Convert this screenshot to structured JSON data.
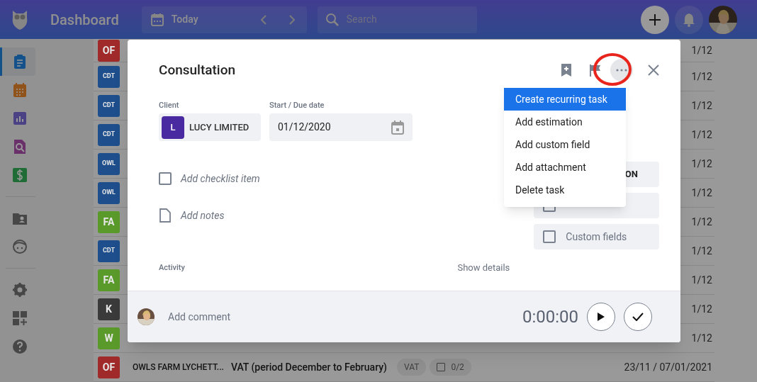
{
  "header": {
    "title": "Dashboard",
    "date_label": "Today",
    "search": {
      "placeholder": "Search"
    }
  },
  "sidebar": {
    "groups": [
      [
        {
          "selected": true
        },
        {
          "selected": false
        },
        {
          "selected": false
        },
        {
          "selected": false
        },
        {
          "selected": false
        }
      ],
      [
        {
          "selected": false
        },
        {
          "selected": false
        }
      ],
      [
        {
          "selected": false
        },
        {
          "selected": false
        },
        {
          "selected": false
        }
      ]
    ]
  },
  "task_rows": [
    {
      "badge": "OF",
      "color": "#a02a2a",
      "date": "1/12"
    },
    {
      "badge": "CDT",
      "color": "#1e4f8c",
      "date": "1/12"
    },
    {
      "badge": "CDT",
      "color": "#1e4f8c",
      "date": "1/12"
    },
    {
      "badge": "CDT",
      "color": "#1e4f8c",
      "date": "1/12"
    },
    {
      "badge": "OWL",
      "color": "#1e4f8c",
      "date": "1/12"
    },
    {
      "badge": "OWL",
      "color": "#1e4f8c",
      "date": "1/12"
    },
    {
      "badge": "FA",
      "color": "#5a9a2a",
      "date": "1/12"
    },
    {
      "badge": "CDT",
      "color": "#1e4f8c",
      "date": "1/12"
    },
    {
      "badge": "FA",
      "color": "#5a9a2a",
      "date": "1/12"
    },
    {
      "badge": "K",
      "color": "#3a3a3a",
      "date": "1/12"
    },
    {
      "badge": "W",
      "color": "#5a9a2a",
      "date": "1/12"
    },
    {
      "badge": "OF",
      "color": "#a02a2a",
      "client": "OWLS FARM LYCHETT...",
      "title": "VAT (period December to February)",
      "tag": "VAT",
      "checklist": "0/2",
      "date": "23/11 / 07/01/2021"
    }
  ],
  "modal": {
    "title": "Consultation",
    "client_label": "Client",
    "client": {
      "initial": "L",
      "name": "LUCY LIMITED"
    },
    "date_label": "Start / Due date",
    "date": "01/12/2020",
    "checklist_item": {
      "placeholder": "Add checklist item",
      "checked": false
    },
    "notes_placeholder": "Add notes",
    "activity_label": "Activity",
    "show_details": "Show details",
    "side_buttons": [
      {
        "kind": "text",
        "label": "ON"
      },
      {
        "kind": "checkbox",
        "checked": false
      },
      {
        "kind": "checkbox",
        "checked": false,
        "label": "Custom fields"
      }
    ],
    "menu": {
      "expanded": true,
      "items": [
        {
          "label": "Create recurring task",
          "selected": true
        },
        {
          "label": "Add estimation",
          "selected": false
        },
        {
          "label": "Add custom field",
          "selected": false
        },
        {
          "label": "Add attachment",
          "selected": false
        },
        {
          "label": "Delete task",
          "selected": false
        }
      ]
    },
    "comment_placeholder": "Add comment",
    "timer": "0:00:00"
  }
}
